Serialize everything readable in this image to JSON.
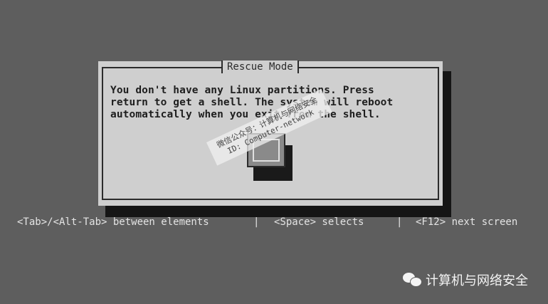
{
  "dialog": {
    "title": "Rescue Mode",
    "message": "You don't have any Linux partitions. Press\nreturn to get a shell. The system will reboot\nautomatically when you exit from the shell."
  },
  "watermark": {
    "line1": "微信公众号：计算机与网络安全",
    "line2": "ID: Computer-network"
  },
  "brand": {
    "name": "计算机与网络安全",
    "icon": "wechat-icon"
  },
  "statusbar": {
    "items": [
      "<Tab>/<Alt-Tab> between elements",
      "<Space> selects",
      "<F12> next screen"
    ],
    "separator": "|"
  },
  "colors": {
    "background": "#5e5e5e",
    "dialog": "#cfcfcf",
    "shadow": "#151515",
    "text": "#1e1e1e",
    "status_text": "#e4e4e4"
  }
}
